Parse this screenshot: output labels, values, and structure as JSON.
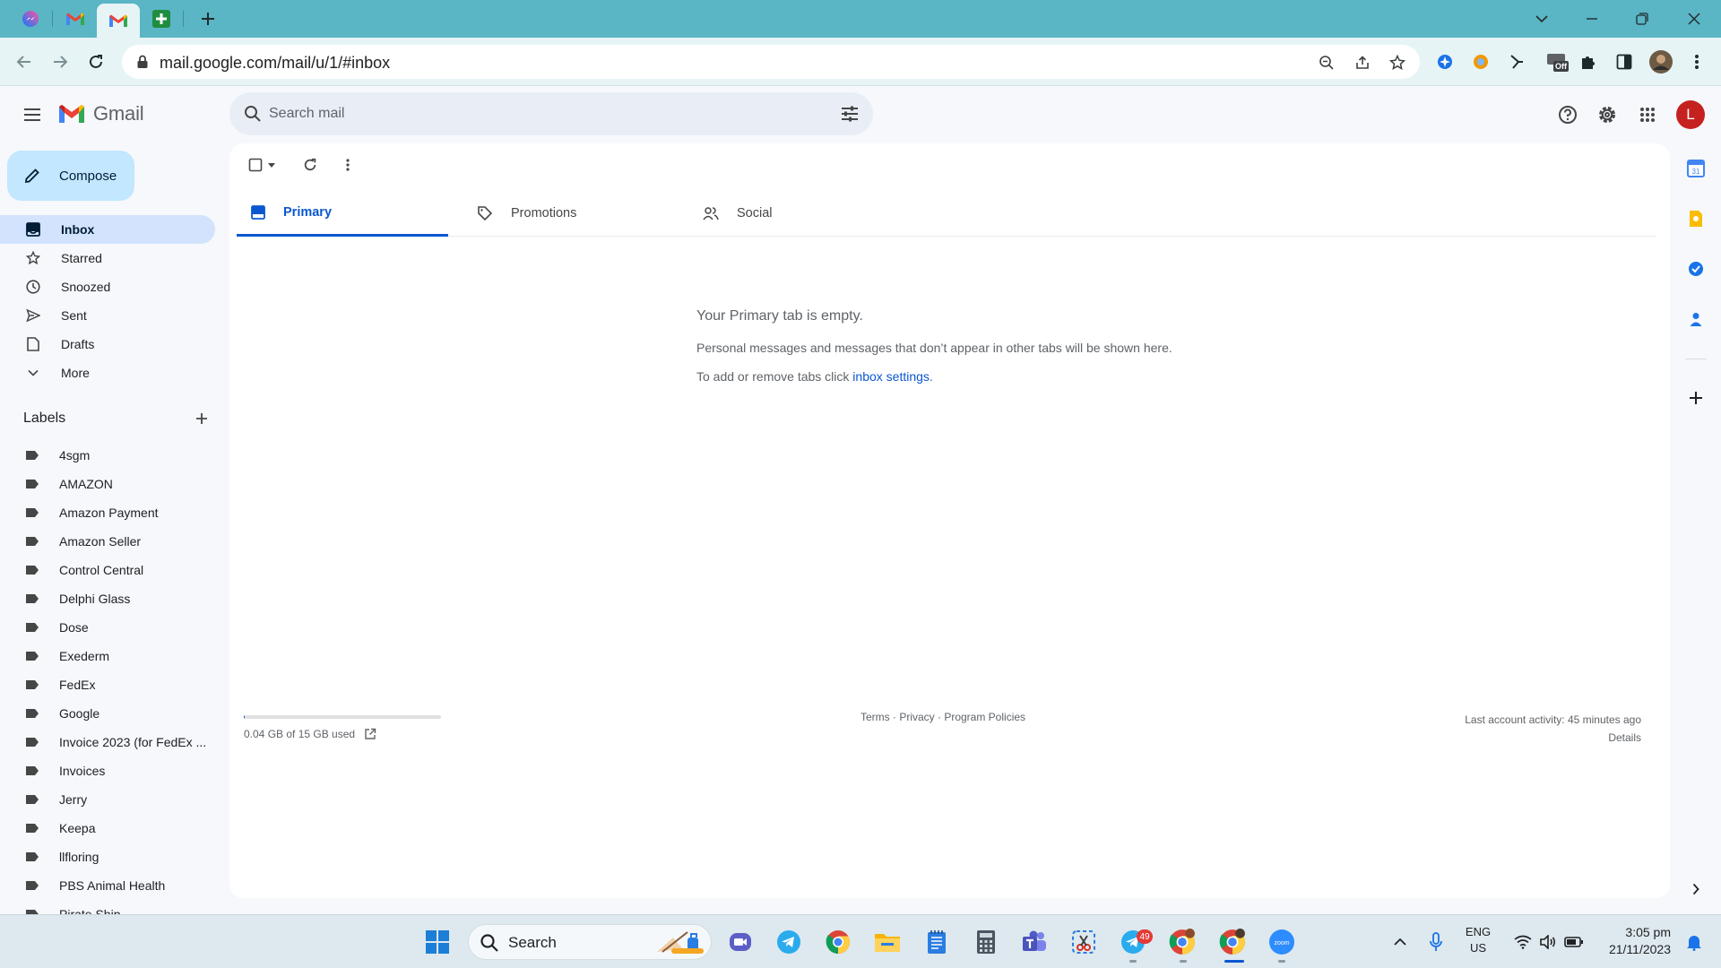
{
  "browser": {
    "url": "mail.google.com/mail/u/1/#inbox",
    "tabs": [
      "messenger-tab",
      "gmail-tab",
      "gmail-tab-active",
      "sheets-tab"
    ],
    "ext_off_badge": "Off"
  },
  "gmail": {
    "app_name": "Gmail",
    "search_placeholder": "Search mail",
    "avatar_initial": "L",
    "compose_label": "Compose",
    "nav": [
      {
        "label": "Inbox",
        "icon": "inbox-icon"
      },
      {
        "label": "Starred",
        "icon": "star-icon"
      },
      {
        "label": "Snoozed",
        "icon": "clock-icon"
      },
      {
        "label": "Sent",
        "icon": "send-icon"
      },
      {
        "label": "Drafts",
        "icon": "draft-icon"
      },
      {
        "label": "More",
        "icon": "chevron-down-icon"
      }
    ],
    "labels_heading": "Labels",
    "labels": [
      "4sgm",
      "AMAZON",
      "Amazon Payment",
      "Amazon Seller",
      "Control Central",
      "Delphi Glass",
      "Dose",
      "Exederm",
      "FedEx",
      "Google",
      "Invoice 2023 (for FedEx ...",
      "Invoices",
      "Jerry",
      "Keepa",
      "llfloring",
      "PBS Animal Health",
      "Pirate Ship"
    ],
    "tabs": [
      "Primary",
      "Promotions",
      "Social"
    ],
    "empty_title": "Your Primary tab is empty.",
    "empty_text": "Personal messages and messages that don’t appear in other tabs will be shown here.",
    "empty_settings_prefix": "To add or remove tabs click ",
    "empty_settings_link": "inbox settings",
    "empty_settings_suffix": ".",
    "storage_text": "0.04 GB of 15 GB used",
    "storage_fraction": 0.0027,
    "footer_links": "Terms · Privacy · Program Policies",
    "last_activity": "Last account activity: 45 minutes ago",
    "details_link": "Details"
  },
  "taskbar": {
    "search_label": "Search",
    "telegram_badge": "49",
    "lang_line1": "ENG",
    "lang_line2": "US",
    "time": "3:05 pm",
    "date": "21/11/2023"
  },
  "colors": {
    "tabbar": "#5ab5c4",
    "accent": "#0b57d0",
    "compose_bg": "#c2e7ff",
    "active_nav": "#d3e3fd",
    "avatar": "#c5221f"
  }
}
